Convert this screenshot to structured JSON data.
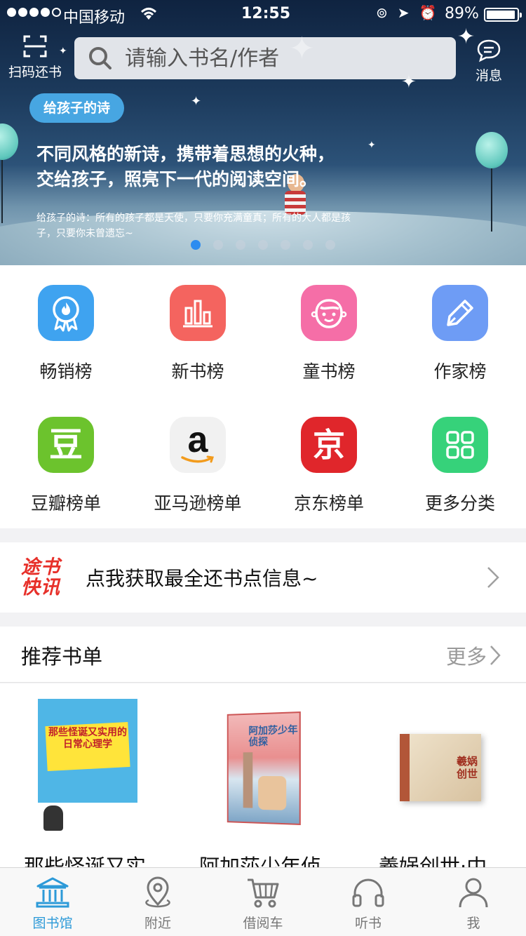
{
  "status_bar": {
    "carrier": "中国移动",
    "time": "12:55",
    "battery": "89%",
    "battery_level": 0.89
  },
  "header": {
    "scan_label": "扫码还书",
    "search_placeholder": "请输入书名/作者",
    "message_label": "消息"
  },
  "banner": {
    "tag": "给孩子的诗",
    "headline_line1": "不同风格的新诗，携带着思想的火种，",
    "headline_line2": "交给孩子，照亮下一代的阅读空间。",
    "subtext": "给孩子的诗：所有的孩子都是天使，只要你充满童真；所有的大人都是孩子，只要你未曾遗忘~",
    "page_count": 7,
    "active_page": 1
  },
  "categories": [
    {
      "label": "畅销榜",
      "icon": "award-badge-icon",
      "color": "#3fa3f0"
    },
    {
      "label": "新书榜",
      "icon": "bar-chart-icon",
      "color": "#f4645f"
    },
    {
      "label": "童书榜",
      "icon": "baby-face-icon",
      "color": "#f56ea7"
    },
    {
      "label": "作家榜",
      "icon": "pen-icon",
      "color": "#6e9cf5"
    },
    {
      "label": "豆瓣榜单",
      "icon": "douban-logo-icon",
      "color": "#6cc32d"
    },
    {
      "label": "亚马逊榜单",
      "icon": "amazon-logo-icon",
      "color": "#f1f1f1"
    },
    {
      "label": "京东榜单",
      "icon": "jd-logo-icon",
      "color": "#e0262b"
    },
    {
      "label": "更多分类",
      "icon": "grid-icon",
      "color": "#36d27a"
    }
  ],
  "category_glyphs": {
    "douban": "豆",
    "jd": "京",
    "amazon": "a"
  },
  "news": {
    "logo_line1": "途书",
    "logo_line2": "快讯",
    "text": "点我获取最全还书点信息~"
  },
  "recommended": {
    "title": "推荐书单",
    "more": "更多",
    "books": [
      {
        "title": "那些怪诞又实",
        "cover_text": "那些怪诞又实用的日常心理学"
      },
      {
        "title": "阿加莎少年侦",
        "cover_text": "阿加莎少年侦探"
      },
      {
        "title": "羲娲创世·中",
        "cover_text": "羲娲创世"
      }
    ]
  },
  "tabs": [
    {
      "label": "图书馆",
      "icon": "library-icon",
      "active": true
    },
    {
      "label": "附近",
      "icon": "location-pin-icon",
      "active": false
    },
    {
      "label": "借阅车",
      "icon": "cart-icon",
      "active": false
    },
    {
      "label": "听书",
      "icon": "headphones-icon",
      "active": false
    },
    {
      "label": "我",
      "icon": "user-icon",
      "active": false
    }
  ],
  "colors": {
    "accent": "#2d9ad8",
    "tag_bg": "#47a6e2",
    "news_logo": "#e7302a"
  }
}
